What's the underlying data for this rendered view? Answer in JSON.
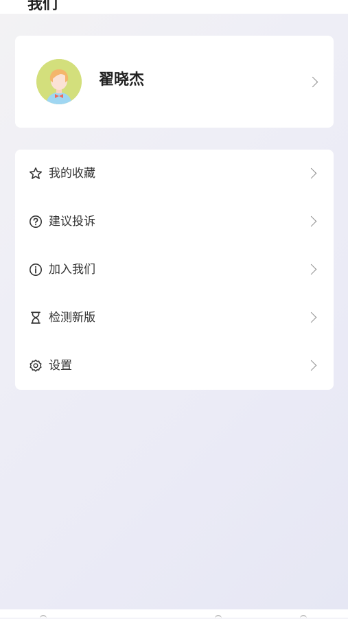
{
  "header": {
    "title_fragment": "我们"
  },
  "profile": {
    "name": "翟晓杰",
    "avatar_icon": "cartoon-child-avatar",
    "avatar_bg": "#d3df7c"
  },
  "menu": {
    "items": [
      {
        "label": "我的收藏",
        "icon": "star-icon"
      },
      {
        "label": "建议投诉",
        "icon": "question-circle-icon"
      },
      {
        "label": "加入我们",
        "icon": "info-circle-icon"
      },
      {
        "label": "检测新版",
        "icon": "hourglass-icon"
      },
      {
        "label": "设置",
        "icon": "gear-icon"
      }
    ]
  }
}
